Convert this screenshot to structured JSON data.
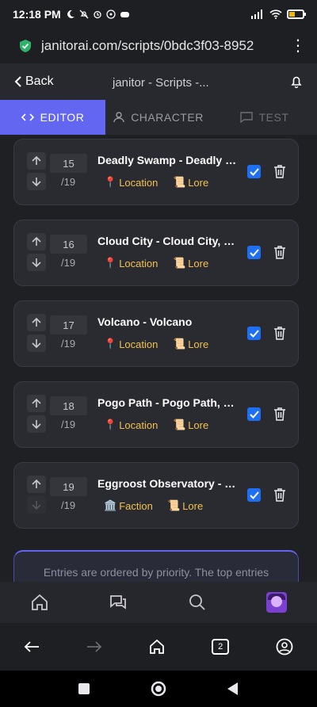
{
  "status": {
    "time": "12:18 PM",
    "battery_level": 0.4,
    "battery_color": "#f2b705"
  },
  "browser": {
    "url": "janitorai.com/scripts/0bdc3f03-8952",
    "tab_count": "2"
  },
  "app_nav": {
    "back_label": "Back",
    "title": "janitor - Scripts -..."
  },
  "tabs": [
    {
      "label": "EDITOR",
      "icon": "code-icon",
      "active": true
    },
    {
      "label": "CHARACTER",
      "icon": "person-icon",
      "active": false
    },
    {
      "label": "TEST",
      "icon": "chat-icon",
      "active": false
    }
  ],
  "entries": [
    {
      "priority": "15",
      "total": "/19",
      "name": "Deadly Swamp - Deadly S...",
      "tag1": {
        "icon": "pin-icon",
        "glyph": "📍",
        "label": "Location"
      },
      "tag2": {
        "icon": "scroll-icon",
        "glyph": "📜",
        "label": "Lore"
      },
      "enabled": true
    },
    {
      "priority": "16",
      "total": "/19",
      "name": "Cloud City - Cloud City, Cl...",
      "tag1": {
        "icon": "pin-icon",
        "glyph": "📍",
        "label": "Location"
      },
      "tag2": {
        "icon": "scroll-icon",
        "glyph": "📜",
        "label": "Lore"
      },
      "enabled": true
    },
    {
      "priority": "17",
      "total": "/19",
      "name": "Volcano - Volcano",
      "tag1": {
        "icon": "pin-icon",
        "glyph": "📍",
        "label": "Location"
      },
      "tag2": {
        "icon": "scroll-icon",
        "glyph": "📜",
        "label": "Lore"
      },
      "enabled": true
    },
    {
      "priority": "18",
      "total": "/19",
      "name": "Pogo Path - Pogo Path, P...",
      "tag1": {
        "icon": "pin-icon",
        "glyph": "📍",
        "label": "Location"
      },
      "tag2": {
        "icon": "scroll-icon",
        "glyph": "📜",
        "label": "Lore"
      },
      "enabled": true
    },
    {
      "priority": "19",
      "total": "/19",
      "name": "Eggroost Observatory - O...",
      "tag1": {
        "icon": "building-icon",
        "glyph": "🏛️",
        "label": "Faction"
      },
      "tag2": {
        "icon": "scroll-icon",
        "glyph": "📜",
        "label": "Lore"
      },
      "enabled": true
    }
  ],
  "info_text": "Entries are ordered by priority. The top entries",
  "colors": {
    "accent": "#6366f1",
    "tag": "#f2c14e",
    "checkbox": "#1e6ff2"
  }
}
